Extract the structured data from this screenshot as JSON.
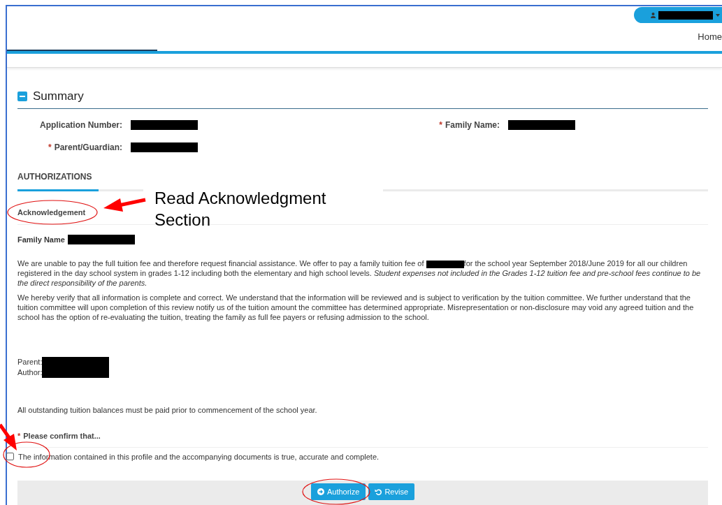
{
  "nav": {
    "home": "Home"
  },
  "section": {
    "title": "Summary",
    "expanded": true
  },
  "required_mark": "*",
  "fields": [
    {
      "label": "Application Number:",
      "required": false
    },
    {
      "label": "Family Name:",
      "required": true
    },
    {
      "label": "Parent/Guardian:",
      "required": true
    }
  ],
  "tabs": [
    {
      "label": "AUTHORIZATIONS",
      "selected": true
    }
  ],
  "acknowledgement": {
    "heading": "Acknowledgement",
    "family_label": "Family Name",
    "paragraph_1_before": "We are unable to pay the full tuition fee and therefore request financial assistance. We offer to pay a family tuition fee of",
    "paragraph_1_after": "for the school year September 2018/June 2019 for all our children registered in the day school system in grades 1-12 including both the elementary and high school levels. *Student expenses not included in the Grades 1-12 tuition fee and pre-school fees continue to be the direct responsibility of the parents.*",
    "paragraph_2": "We hereby verify that all information is complete and correct. We understand that the information will be reviewed and is subject to verification by the tuition committee. We further understand that the tuition committee will upon completion of this review notify us of the tuition amount the committee has determined appropriate. Misrepresentation or non-disclosure may void any agreed tuition and the school has the option of re-evaluating the tuition, treating the family as full fee payers or refusing admission to the school.",
    "signatures": [
      "Parent:",
      "Author:"
    ],
    "notice": "All outstanding tuition balances must be paid prior to commencement of the school year."
  },
  "confirm": {
    "label": "Please confirm that...",
    "required": true,
    "checkbox": {
      "label": "The information contained in this profile and the accompanying documents is true, accurate and complete.",
      "checked": false
    }
  },
  "buttons": [
    {
      "label": "Authorize",
      "kind": "authorize"
    },
    {
      "label": "Revise",
      "kind": "revise"
    }
  ],
  "annotation": {
    "callout": "Read Acknowledgment Section"
  }
}
